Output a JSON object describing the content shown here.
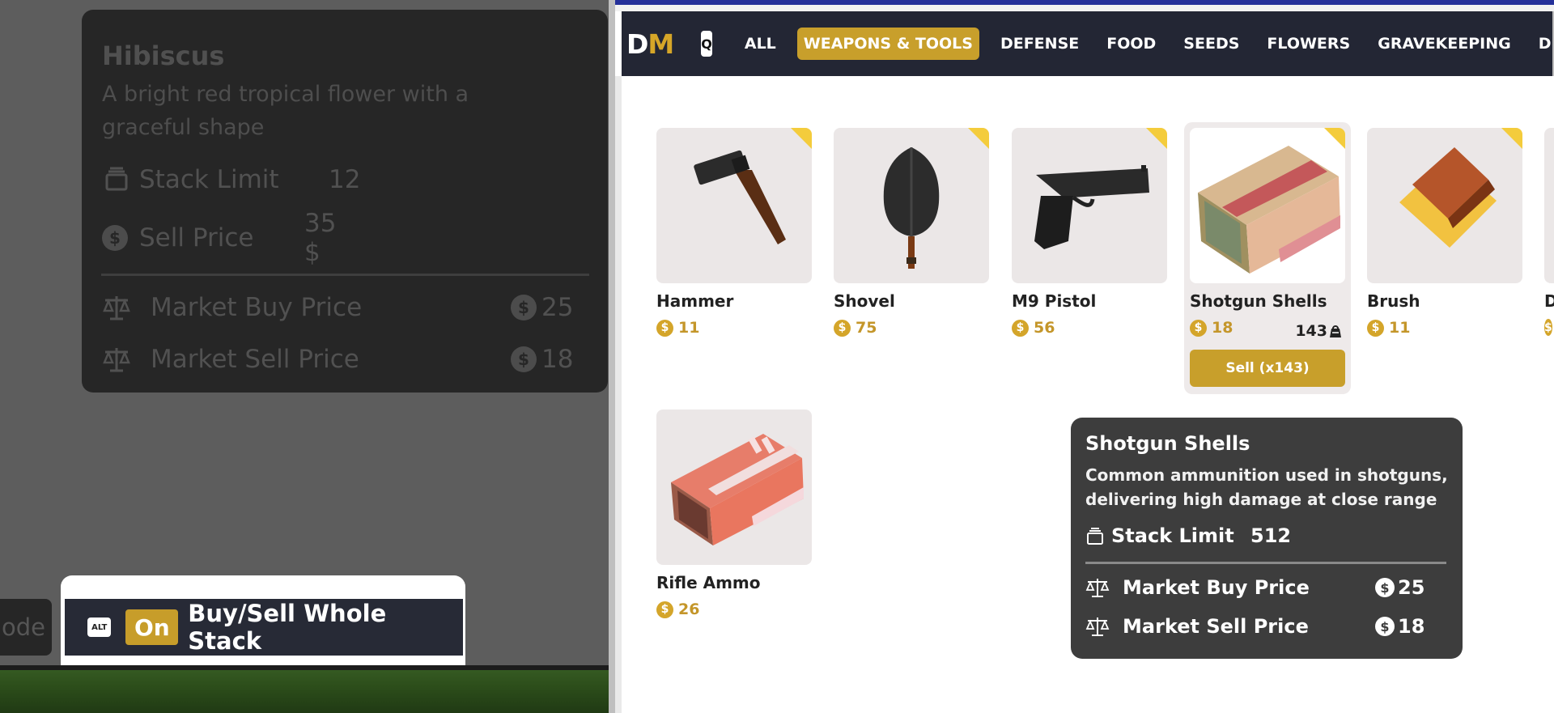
{
  "left_tooltip": {
    "title": "Hibiscus",
    "description": "A bright red tropical flower with a graceful shape",
    "stack_limit_label": "Stack Limit",
    "stack_limit_value": "12",
    "sell_price_label": "Sell Price",
    "sell_price_value": "35 $",
    "market_buy_label": "Market Buy Price",
    "market_buy_value": "25",
    "market_sell_label": "Market Sell Price",
    "market_sell_value": "18"
  },
  "bottom_bar": {
    "prev_chip_text": "ode",
    "alt_key": "ALT",
    "on_badge": "On",
    "label": "Buy/Sell Whole Stack"
  },
  "navbar": {
    "logo_d": "D",
    "logo_m": "M",
    "q_key": "Q",
    "tabs": [
      "ALL",
      "WEAPONS & TOOLS",
      "DEFENSE",
      "FOOD",
      "SEEDS",
      "FLOWERS",
      "GRAVEKEEPING",
      "DECORATIO"
    ],
    "active_tab": "WEAPONS & TOOLS"
  },
  "items": [
    {
      "name": "Hammer",
      "price": "11"
    },
    {
      "name": "Shovel",
      "price": "75"
    },
    {
      "name": "M9 Pistol",
      "price": "56"
    },
    {
      "name": "Shotgun Shells",
      "price": "18",
      "owned": "143",
      "sell_label": "Sell (x143)"
    },
    {
      "name": "Brush",
      "price": "11"
    },
    {
      "name": "D",
      "price": ""
    },
    {
      "name": "Rifle Ammo",
      "price": "26"
    }
  ],
  "right_tooltip": {
    "title": "Shotgun Shells",
    "description": "Common ammunition used in shotguns, delivering high damage at close range",
    "stack_limit_label": "Stack Limit",
    "stack_limit_value": "512",
    "market_buy_label": "Market Buy Price",
    "market_buy_value": "25",
    "market_sell_label": "Market Sell Price",
    "market_sell_value": "18"
  },
  "colors": {
    "accent_gold": "#c89f2b",
    "nav_bg": "#232634",
    "tooltip_bg": "#3d3d3d"
  },
  "icons": {
    "stack": "stack-icon",
    "coin": "coin-icon",
    "scale": "scale-icon",
    "bag": "bag-icon"
  }
}
